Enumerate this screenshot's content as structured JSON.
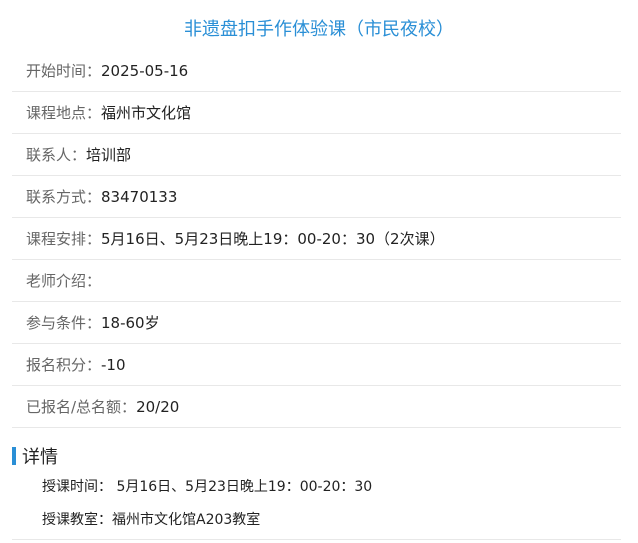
{
  "title": "非遗盘扣手作体验课（市民夜校）",
  "info": [
    {
      "label": "开始时间：",
      "value": "2025-05-16"
    },
    {
      "label": "课程地点：",
      "value": "福州市文化馆"
    },
    {
      "label": "联系人：",
      "value": "培训部"
    },
    {
      "label": "联系方式：",
      "value": "83470133"
    },
    {
      "label": "课程安排：",
      "value": " 5月16日、5月23日晚上19：00-20：30（2次课）"
    },
    {
      "label": "老师介绍：",
      "value": ""
    },
    {
      "label": "参与条件：",
      "value": " 18-60岁"
    },
    {
      "label": "报名积分：",
      "value": "-10"
    },
    {
      "label": "已报名/总名额：",
      "value": "20/20"
    }
  ],
  "section": {
    "title": "详情"
  },
  "details": [
    {
      "label": "授课时间：",
      "value": " 5月16日、5月23日晚上19：00-20：30"
    },
    {
      "label": "授课教室：",
      "value": "福州市文化馆A203教室"
    }
  ],
  "colors": {
    "accent": "#2a8fd6",
    "label": "#666666",
    "text": "#222222",
    "divider": "#e8e8e8"
  }
}
